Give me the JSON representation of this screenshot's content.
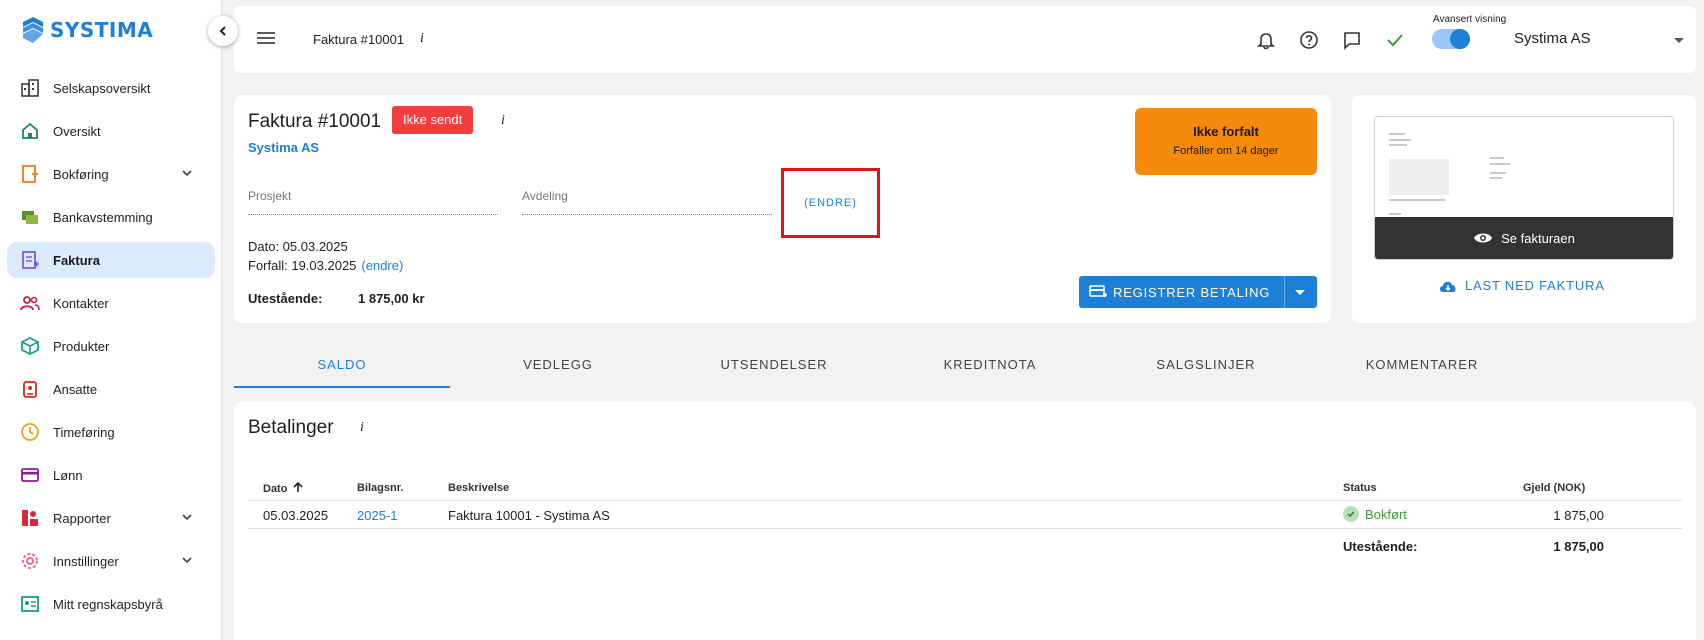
{
  "app": {
    "logo_text": "SYSTIMA",
    "accent_color": "#1e7fd6"
  },
  "sidebar": {
    "items": [
      {
        "label": "Selskapsoversikt",
        "icon": "building-icon"
      },
      {
        "label": "Oversikt",
        "icon": "home-icon"
      },
      {
        "label": "Bokføring",
        "icon": "bookkeeping-icon",
        "expandable": true
      },
      {
        "label": "Bankavstemming",
        "icon": "bank-reconcile-icon"
      },
      {
        "label": "Faktura",
        "icon": "invoice-icon",
        "active": true
      },
      {
        "label": "Kontakter",
        "icon": "contacts-icon"
      },
      {
        "label": "Produkter",
        "icon": "product-box-icon"
      },
      {
        "label": "Ansatte",
        "icon": "employee-badge-icon"
      },
      {
        "label": "Timeføring",
        "icon": "clock-icon"
      },
      {
        "label": "Lønn",
        "icon": "payroll-card-icon"
      },
      {
        "label": "Rapporter",
        "icon": "reports-icon",
        "expandable": true
      },
      {
        "label": "Innstillinger",
        "icon": "settings-gear-icon",
        "expandable": true
      },
      {
        "label": "Mitt regnskapsbyrå",
        "icon": "accounting-firm-icon"
      }
    ]
  },
  "header": {
    "title": "Faktura #10001",
    "info": "i",
    "advanced_view_label": "Avansert visning",
    "advanced_view_on": true,
    "company": "Systima AS"
  },
  "invoice": {
    "title": "Faktura #10001",
    "status_badge": "Ikke sendt",
    "info": "i",
    "company": "Systima AS",
    "project_label": "Prosjekt",
    "department_label": "Avdeling",
    "change_link": "(ENDRE)",
    "date_text": "Dato: 05.03.2025",
    "due_text": "Forfall: 19.03.2025",
    "due_change_link": "(endre)",
    "outstanding_label": "Utestående:",
    "outstanding_value": "1 875,00 kr",
    "due_status_title": "Ikke forfalt",
    "due_status_sub": "Forfaller om 14 dager",
    "register_payment_label": "REGISTRER BETALING"
  },
  "preview": {
    "view_label": "Se fakturaen",
    "download_label": "LAST NED FAKTURA"
  },
  "tabs": [
    {
      "label": "SALDO",
      "active": true
    },
    {
      "label": "VEDLEGG"
    },
    {
      "label": "UTSENDELSER"
    },
    {
      "label": "KREDITNOTA"
    },
    {
      "label": "SALGSLINJER"
    },
    {
      "label": "KOMMENTARER"
    }
  ],
  "payments": {
    "title": "Betalinger",
    "info": "i",
    "columns": {
      "date": "Dato",
      "voucher": "Bilagsnr.",
      "description": "Beskrivelse",
      "status": "Status",
      "debt": "Gjeld (NOK)"
    },
    "rows": [
      {
        "date": "05.03.2025",
        "voucher": "2025-1",
        "description": "Faktura 10001 - Systima AS",
        "status": "Bokført",
        "debt": "1 875,00"
      }
    ],
    "outstanding_label": "Utestående:",
    "outstanding_value": "1 875,00"
  }
}
